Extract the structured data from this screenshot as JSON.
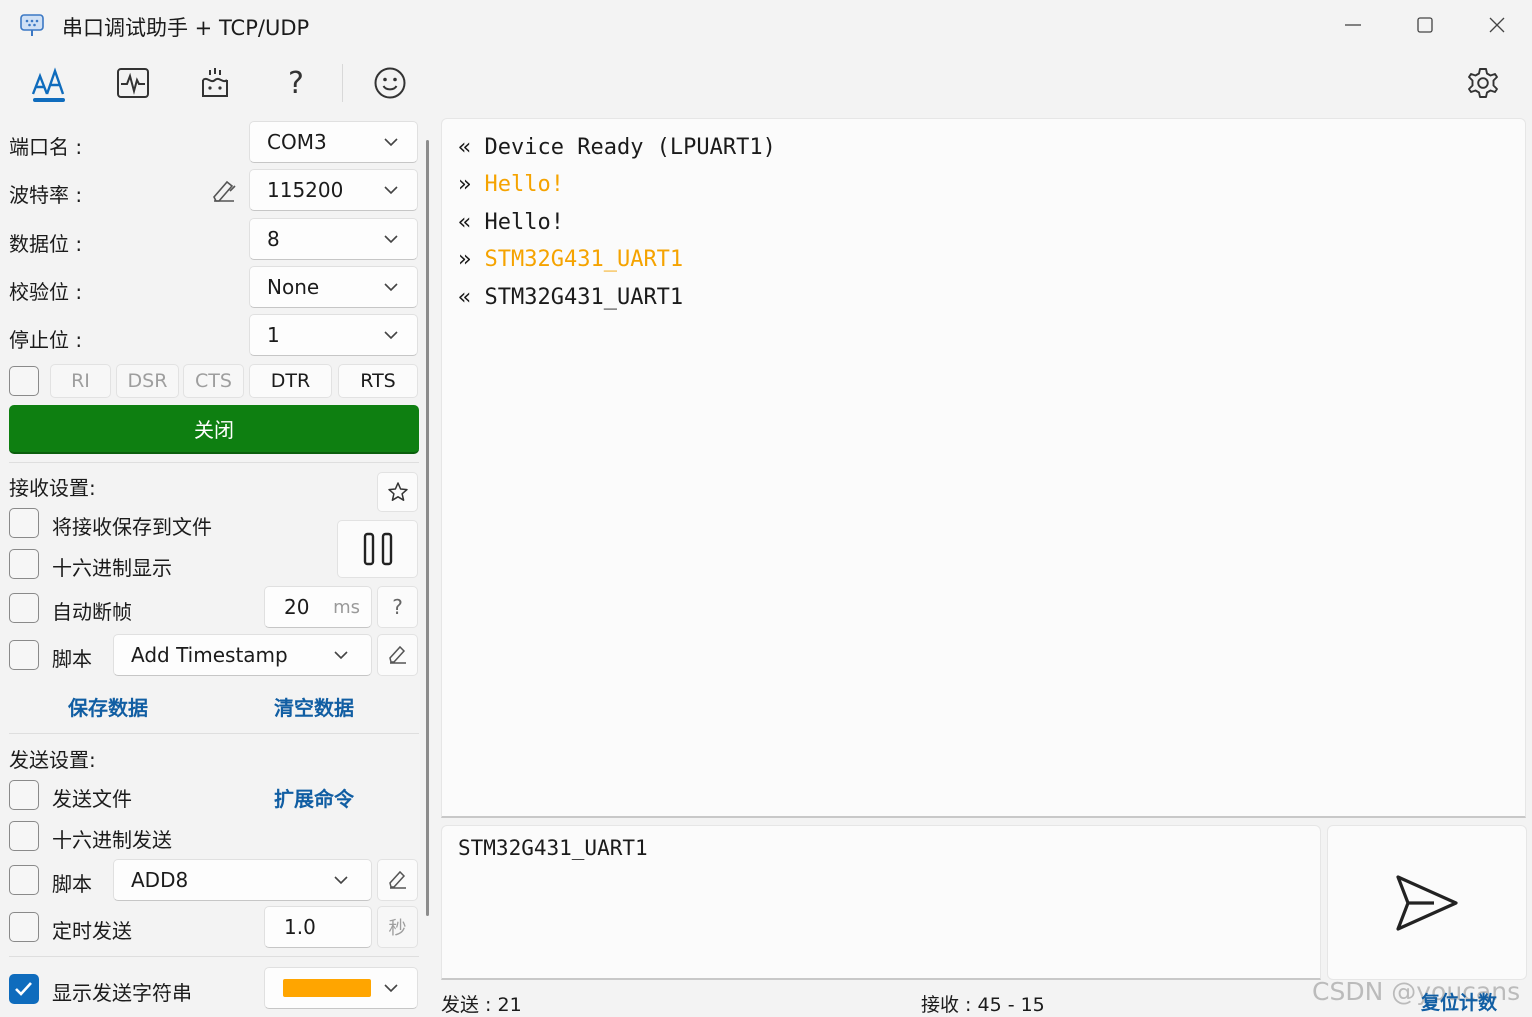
{
  "app": {
    "title": "串口调试助手 + TCP/UDP",
    "icon": "serial-port-app-icon"
  },
  "window_controls": {
    "minimize": "—",
    "maximize": "☐",
    "close": "✕"
  },
  "toolbar": {
    "items": [
      {
        "name": "text-mode-icon",
        "selected": true
      },
      {
        "name": "waveform-icon",
        "selected": false
      },
      {
        "name": "plugin-icon",
        "selected": false
      },
      {
        "name": "help-icon",
        "text": "?"
      },
      {
        "name": "smile-icon",
        "selected": false
      }
    ],
    "settings": "gear-icon",
    "accent": "#0f6cbd"
  },
  "port_settings": {
    "port_label": "端口名 :",
    "port_value": "COM3",
    "baud_label": "波特率 :",
    "baud_value": "115200",
    "data_bits_label": "数据位 :",
    "data_bits_value": "8",
    "parity_label": "校验位 :",
    "parity_value": "None",
    "stop_bits_label": "停止位 :",
    "stop_bits_value": "1",
    "pins": [
      "RI",
      "DSR",
      "CTS",
      "DTR",
      "RTS"
    ],
    "open_button": "关闭",
    "open_button_color": "#0e7f11"
  },
  "receive_settings": {
    "heading": "接收设置:",
    "save_to_file": "将接收保存到文件",
    "hex_display": "十六进制显示",
    "auto_frame": "自动断帧",
    "frame_ms_value": "20",
    "frame_ms_unit": "ms",
    "frame_help": "?",
    "script_label": "脚本",
    "script_value": "Add Timestamp",
    "save_data": "保存数据",
    "clear_data": "清空数据"
  },
  "send_settings": {
    "heading": "发送设置:",
    "send_file": "发送文件",
    "extended_cmd": "扩展命令",
    "hex_send": "十六进制发送",
    "script_label": "脚本",
    "script_value": "ADD8",
    "timed_send": "定时发送",
    "timed_value": "1.0",
    "timed_unit": "秒",
    "show_sent": "显示发送字符串",
    "show_sent_checked": true,
    "sent_color": "#ffa500"
  },
  "receive_log": [
    {
      "dir": "«",
      "text": "Device Ready (LPUART1)",
      "color": "#1b1b1b"
    },
    {
      "dir": "»",
      "text": "Hello!",
      "color": "#f5a300"
    },
    {
      "dir": "«",
      "text": "Hello!",
      "color": "#1b1b1b"
    },
    {
      "dir": "»",
      "text": "STM32G431_UART1",
      "color": "#f5a300"
    },
    {
      "dir": "«",
      "text": "STM32G431_UART1",
      "color": "#1b1b1b"
    }
  ],
  "send_box": {
    "value": "STM32G431_UART1"
  },
  "status_bar": {
    "sent": "发送 : 21",
    "received": "接收 : 45  -  15",
    "reset": "复位计数"
  },
  "watermark": "CSDN @youcans"
}
